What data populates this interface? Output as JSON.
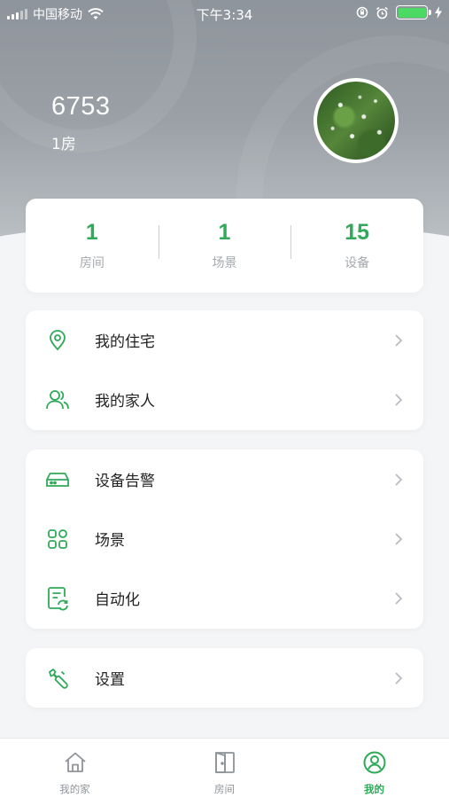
{
  "status_bar": {
    "carrier": "中国移动",
    "time": "下午3:34"
  },
  "profile": {
    "name": "6753",
    "rooms": "1房"
  },
  "stats": [
    {
      "value": "1",
      "label": "房间"
    },
    {
      "value": "1",
      "label": "场景"
    },
    {
      "value": "15",
      "label": "设备"
    }
  ],
  "menu_group_1": [
    {
      "label": "我的住宅",
      "icon": "location-pin-icon"
    },
    {
      "label": "我的家人",
      "icon": "family-icon"
    }
  ],
  "menu_group_2": [
    {
      "label": "设备告警",
      "icon": "device-alarm-icon"
    },
    {
      "label": "场景",
      "icon": "scene-grid-icon"
    },
    {
      "label": "自动化",
      "icon": "automation-icon"
    }
  ],
  "menu_group_3": [
    {
      "label": "设置",
      "icon": "wrench-icon"
    }
  ],
  "tabbar": [
    {
      "label": "我的家",
      "icon": "home-icon",
      "active": false
    },
    {
      "label": "房间",
      "icon": "door-icon",
      "active": false
    },
    {
      "label": "我的",
      "icon": "profile-icon",
      "active": true
    }
  ],
  "colors": {
    "accent": "#2eaa58",
    "muted": "#a5a9ad",
    "battery": "#4cd964"
  }
}
